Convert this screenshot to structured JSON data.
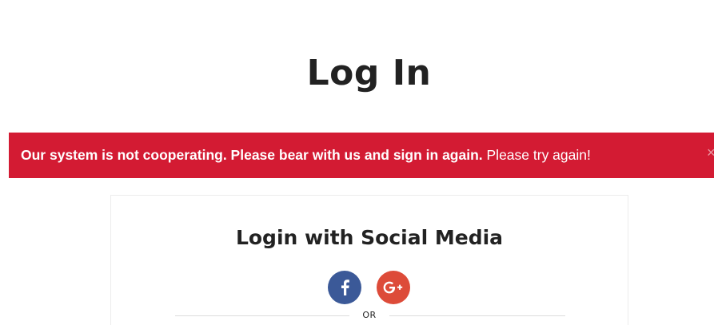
{
  "page": {
    "title": "Log In"
  },
  "alert": {
    "bold_message": "Our system is not cooperating. Please bear with us and sign in again.",
    "message": " Please try again!",
    "close_glyph": "×",
    "background_color": "#d31b33"
  },
  "social_login": {
    "title": "Login with Social Media",
    "buttons": [
      {
        "name": "facebook",
        "icon": "facebook-icon",
        "color": "#3b5998"
      },
      {
        "name": "google-plus",
        "icon": "google-plus-icon",
        "color": "#dd4b39"
      }
    ],
    "divider_text": "OR"
  }
}
